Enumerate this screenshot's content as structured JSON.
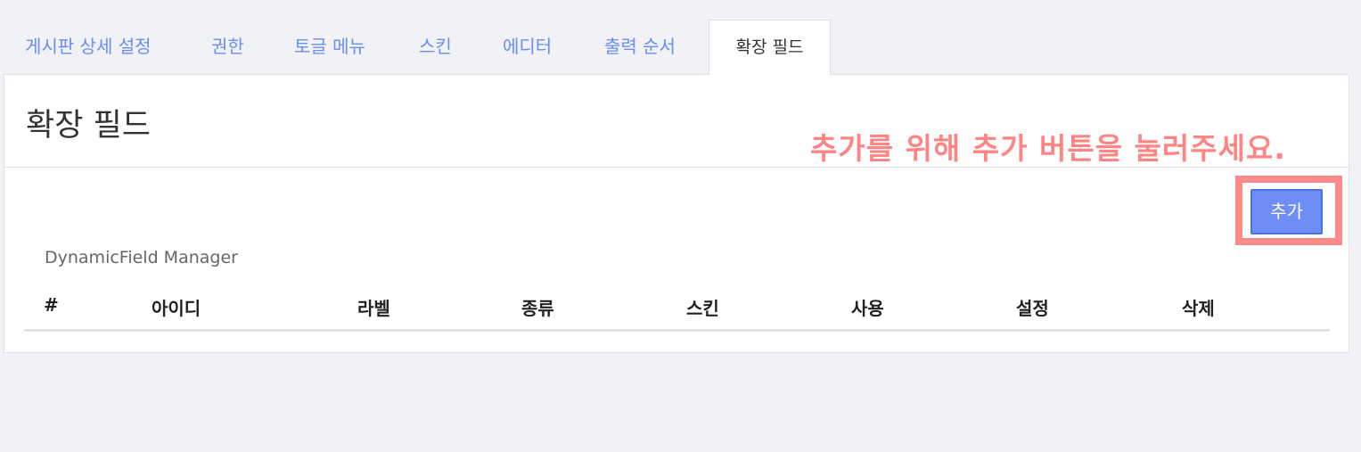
{
  "tabs": [
    {
      "label": "게시판 상세 설정",
      "active": false
    },
    {
      "label": "권한",
      "active": false
    },
    {
      "label": "토글 메뉴",
      "active": false
    },
    {
      "label": "스킨",
      "active": false
    },
    {
      "label": "에디터",
      "active": false
    },
    {
      "label": "출력 순서",
      "active": false
    },
    {
      "label": "확장 필드",
      "active": true
    }
  ],
  "panel": {
    "title": "확장 필드",
    "annotation": "추가를 위해 추가 버튼을 눌러주세요.",
    "add_button_label": "추가",
    "manager_caption": "DynamicField Manager"
  },
  "table": {
    "headers": [
      "#",
      "아이디",
      "라벨",
      "종류",
      "스킨",
      "사용",
      "설정",
      "삭제"
    ]
  },
  "colors": {
    "accent": "#6f8df7",
    "tab_link": "#6b8cf5",
    "annotation": "#ff8585",
    "background": "#f1f2f6"
  }
}
